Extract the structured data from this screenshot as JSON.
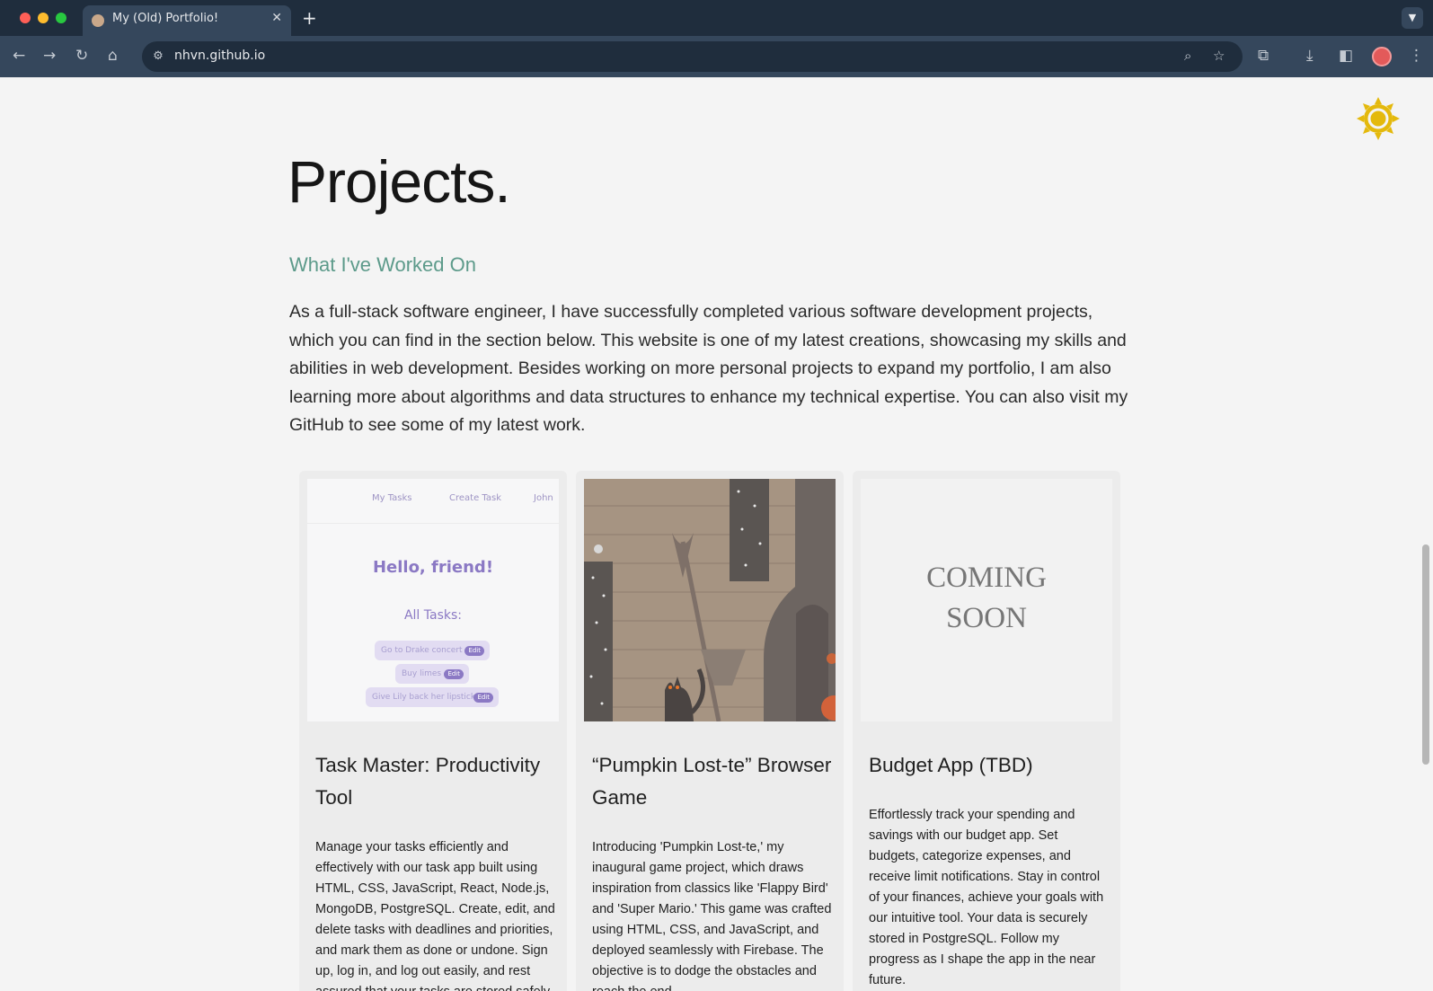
{
  "browser": {
    "tab_title": "My (Old) Portfolio!",
    "url": "nhvn.github.io"
  },
  "page": {
    "heading": "Projects.",
    "subheading": "What I've Worked On",
    "intro": "As a full-stack software engineer, I have successfully completed various software development projects, which you can find in the section below. This website is one of my latest creations, showcasing my skills and abilities in web development. Besides working on more personal projects to expand my portfolio, I am also learning more about algorithms and data structures to enhance my technical expertise. You can also visit my GitHub to see some of my latest work."
  },
  "projects": [
    {
      "title": "Task Master: Productivity Tool",
      "description": "Manage your tasks efficiently and effectively with our task app built using HTML, CSS, JavaScript, React, Node.js, MongoDB, PostgreSQL. Create, edit, and delete tasks with deadlines and priorities, and mark them as done or undone. Sign up, log in, and log out easily, and rest assured that your tasks are stored safely.",
      "preview": {
        "nav": [
          "My Tasks",
          "Create Task",
          "John"
        ],
        "greeting": "Hello, friend!",
        "list_title": "All Tasks:",
        "tasks": [
          "Go to Drake concert",
          "Buy limes",
          "Give Lily back her lipstick"
        ],
        "edit_label": "Edit"
      }
    },
    {
      "title": "“Pumpkin Lost-te” Browser Game",
      "description": "Introducing 'Pumpkin Lost-te,' my inaugural game project, which draws inspiration from classics like 'Flappy Bird' and 'Super Mario.' This game was crafted using HTML, CSS, and JavaScript, and deployed seamlessly with Firebase. The objective is to dodge the obstacles and reach the end."
    },
    {
      "title": "Budget App (TBD)",
      "description": "Effortlessly track your spending and savings with our budget app. Set budgets, categorize expenses, and receive limit notifications. Stay in control of your finances, achieve your goals with our intuitive tool. Your data is securely stored in PostgreSQL. Follow my progress as I shape the app in the near future.",
      "preview": {
        "line1": "COMING",
        "line2": "SOON"
      }
    }
  ],
  "colors": {
    "accent_teal": "#5c9a8a",
    "sun_yellow": "#e4b90c",
    "task_purple": "#8b79c4"
  }
}
